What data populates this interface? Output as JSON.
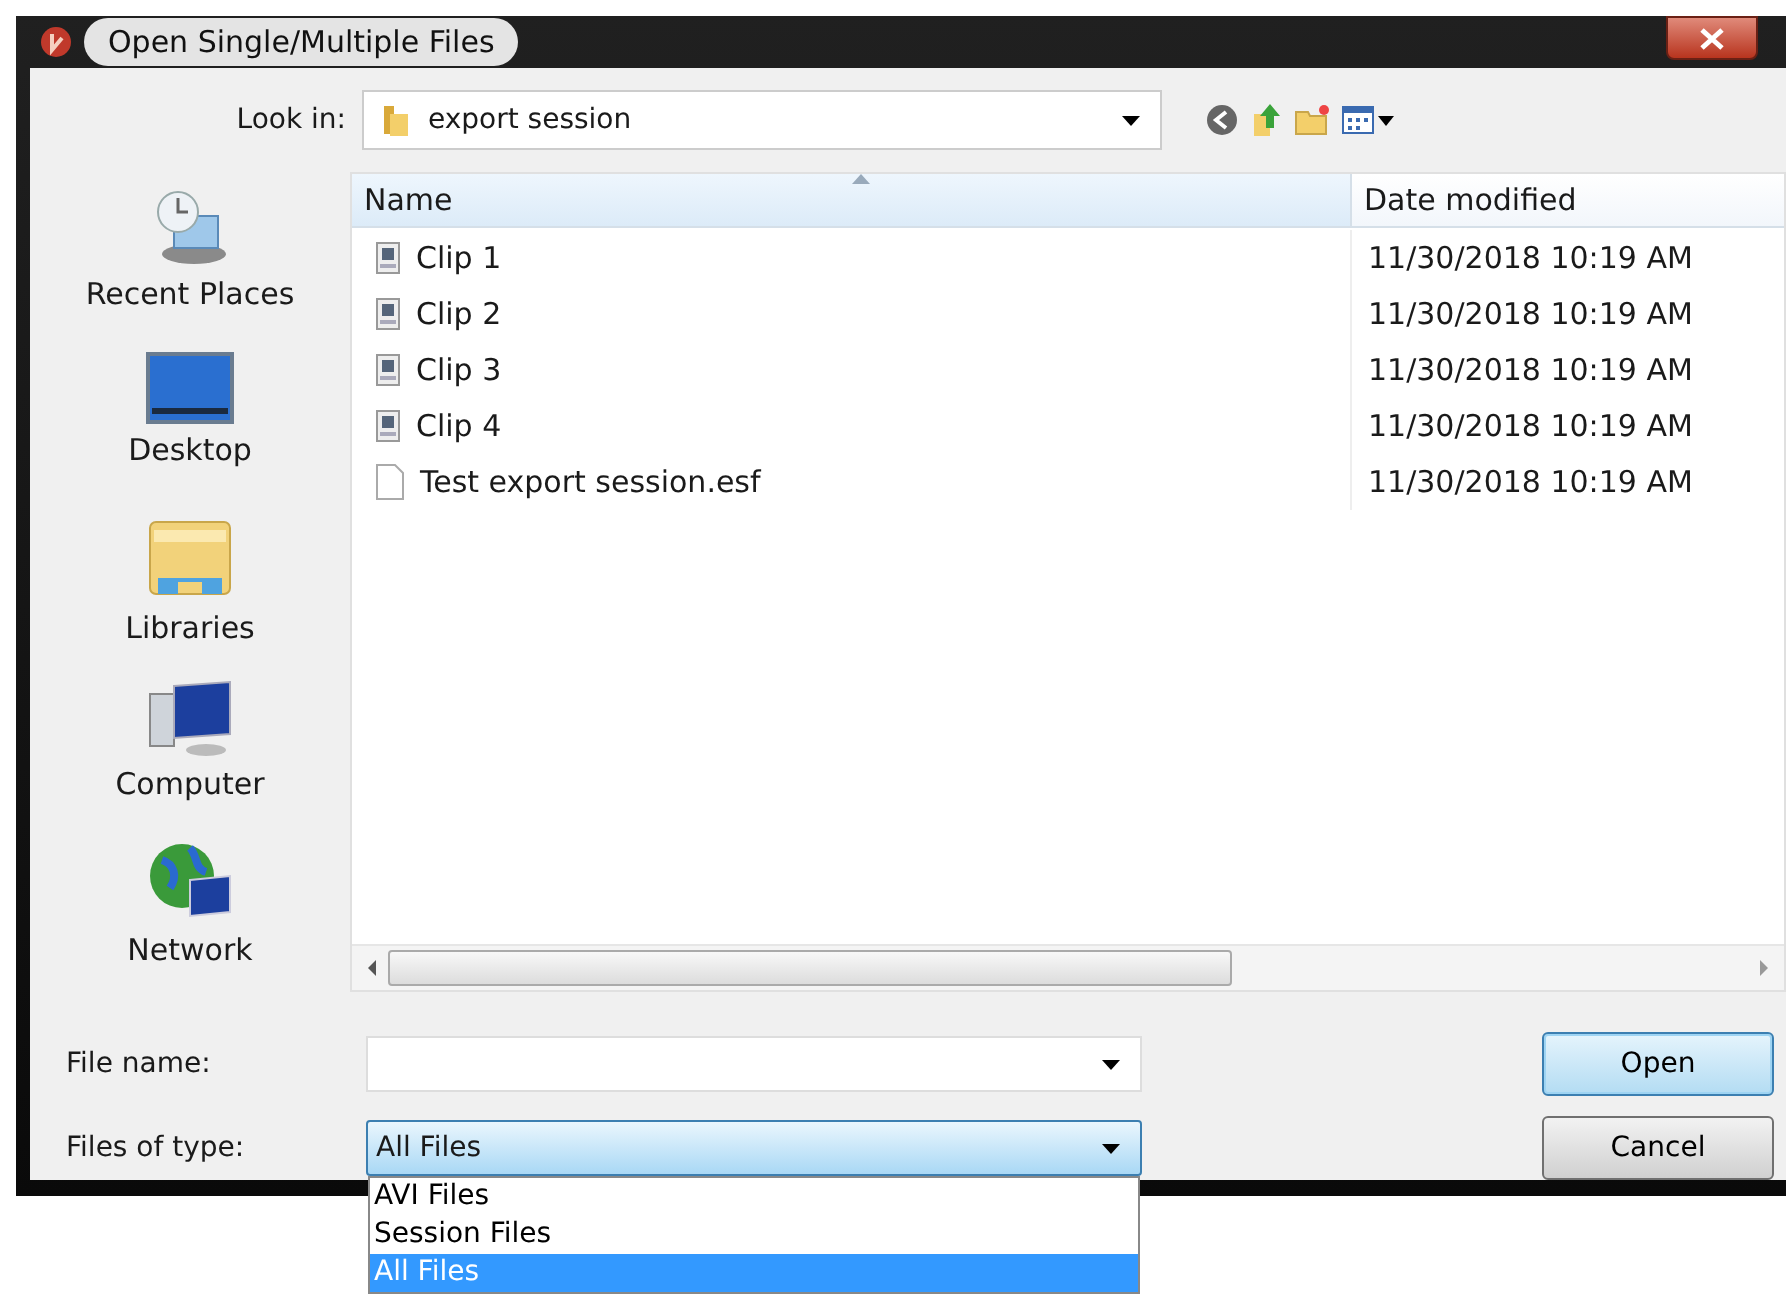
{
  "window": {
    "title": "Open Single/Multiple Files"
  },
  "look_in": {
    "label": "Look in:",
    "value": "export session"
  },
  "places": [
    {
      "label": "Recent Places",
      "kind": "recent"
    },
    {
      "label": "Desktop",
      "kind": "desktop"
    },
    {
      "label": "Libraries",
      "kind": "libraries"
    },
    {
      "label": "Computer",
      "kind": "computer"
    },
    {
      "label": "Network",
      "kind": "network"
    }
  ],
  "file_list": {
    "columns": [
      "Name",
      "Date modified"
    ],
    "rows": [
      {
        "name": "Clip 1",
        "date_modified": "11/30/2018 10:19 AM",
        "kind": "video"
      },
      {
        "name": "Clip 2",
        "date_modified": "11/30/2018 10:19 AM",
        "kind": "video"
      },
      {
        "name": "Clip 3",
        "date_modified": "11/30/2018 10:19 AM",
        "kind": "video"
      },
      {
        "name": "Clip 4",
        "date_modified": "11/30/2018 10:19 AM",
        "kind": "video"
      },
      {
        "name": "Test export session.esf",
        "date_modified": "11/30/2018 10:19 AM",
        "kind": "document"
      }
    ]
  },
  "file_name": {
    "label": "File name:"
  },
  "file_type": {
    "label": "Files of type:",
    "value": "All Files",
    "expanded": true,
    "options": [
      {
        "label": "AVI Files",
        "selected": false
      },
      {
        "label": "Session Files",
        "selected": false
      },
      {
        "label": "All Files",
        "selected": true
      }
    ]
  },
  "buttons": [
    {
      "label": "Open",
      "focused": true
    },
    {
      "label": "Cancel",
      "focused": false
    }
  ]
}
